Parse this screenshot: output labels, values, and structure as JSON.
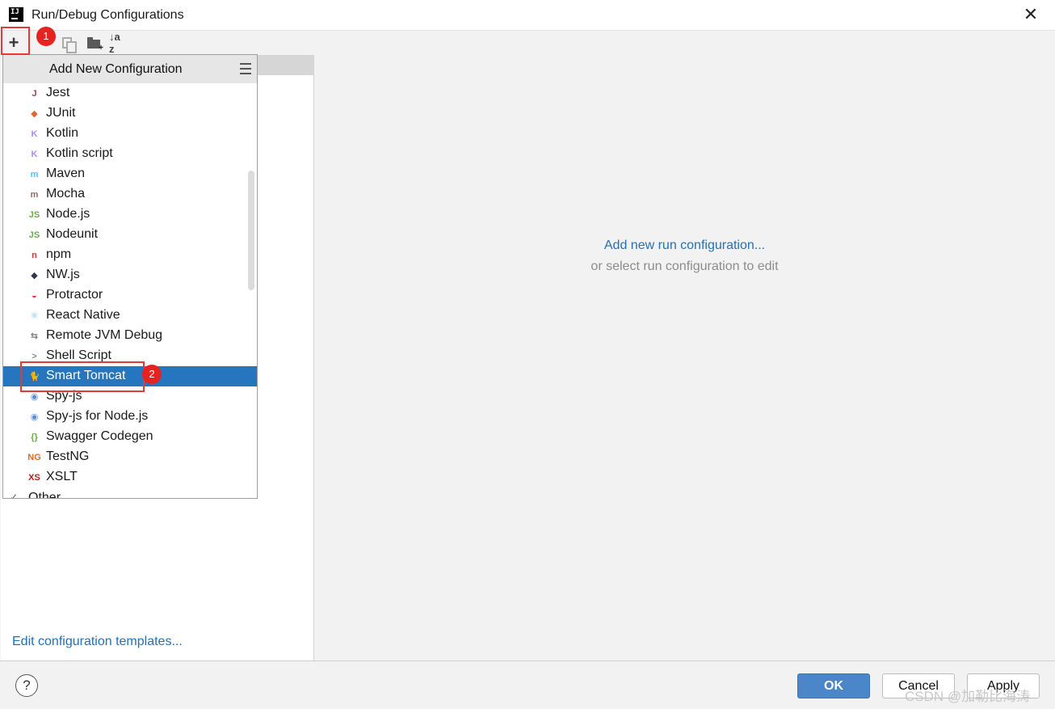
{
  "window": {
    "title": "Run/Debug Configurations",
    "app_icon_text": "IJ"
  },
  "toolbar": {
    "add": "+",
    "sort": "↓a z"
  },
  "annotations": {
    "badge1": "1",
    "badge2": "2"
  },
  "popup": {
    "title": "Add New Configuration",
    "items": [
      {
        "label": "Jest",
        "icon": "jest-icon",
        "color": "#99425b",
        "glyph": "J"
      },
      {
        "label": "JUnit",
        "icon": "junit-icon",
        "color": "#e0672d",
        "glyph": "◆"
      },
      {
        "label": "Kotlin",
        "icon": "kotlin-icon",
        "color": "#a98dfa",
        "glyph": "K"
      },
      {
        "label": "Kotlin script",
        "icon": "kotlin-script-icon",
        "color": "#a98dfa",
        "glyph": "K"
      },
      {
        "label": "Maven",
        "icon": "maven-icon",
        "color": "#4fc3f7",
        "glyph": "m"
      },
      {
        "label": "Mocha",
        "icon": "mocha-icon",
        "color": "#8d6e63",
        "glyph": "m"
      },
      {
        "label": "Node.js",
        "icon": "nodejs-icon",
        "color": "#6aa84f",
        "glyph": "JS"
      },
      {
        "label": "Nodeunit",
        "icon": "nodeunit-icon",
        "color": "#6aa84f",
        "glyph": "JS"
      },
      {
        "label": "npm",
        "icon": "npm-icon",
        "color": "#cb3837",
        "glyph": "n"
      },
      {
        "label": "NW.js",
        "icon": "nwjs-icon",
        "color": "#2d3a4a",
        "glyph": "◆"
      },
      {
        "label": "Protractor",
        "icon": "protractor-icon",
        "color": "#e53935",
        "glyph": "◒"
      },
      {
        "label": "React Native",
        "icon": "react-icon",
        "color": "#4fc3f7",
        "glyph": "⚛"
      },
      {
        "label": "Remote JVM Debug",
        "icon": "remote-debug-icon",
        "color": "#777777",
        "glyph": "⇆"
      },
      {
        "label": "Shell Script",
        "icon": "shell-script-icon",
        "color": "#888888",
        "glyph": ">"
      },
      {
        "label": "Smart Tomcat",
        "icon": "tomcat-icon",
        "color": "#f5b400",
        "glyph": "🐈",
        "selected": true
      },
      {
        "label": "Spy-js",
        "icon": "spyjs-icon",
        "color": "#5c8cd6",
        "glyph": "◉"
      },
      {
        "label": "Spy-js for Node.js",
        "icon": "spyjs-node-icon",
        "color": "#5c8cd6",
        "glyph": "◉"
      },
      {
        "label": "Swagger Codegen",
        "icon": "swagger-icon",
        "color": "#6aa84f",
        "glyph": "{}"
      },
      {
        "label": "TestNG",
        "icon": "testng-icon",
        "color": "#e0672d",
        "glyph": "NG"
      },
      {
        "label": "XSLT",
        "icon": "xslt-icon",
        "color": "#b71c1c",
        "glyph": "XS"
      }
    ],
    "other_label": "Other"
  },
  "left": {
    "edit_templates": "Edit configuration templates..."
  },
  "right": {
    "add_link": "Add new run configuration...",
    "hint": "or select run configuration to edit"
  },
  "footer": {
    "help": "?",
    "ok": "OK",
    "cancel": "Cancel",
    "apply": "Apply",
    "watermark": "CSDN @加勒比海涛"
  }
}
